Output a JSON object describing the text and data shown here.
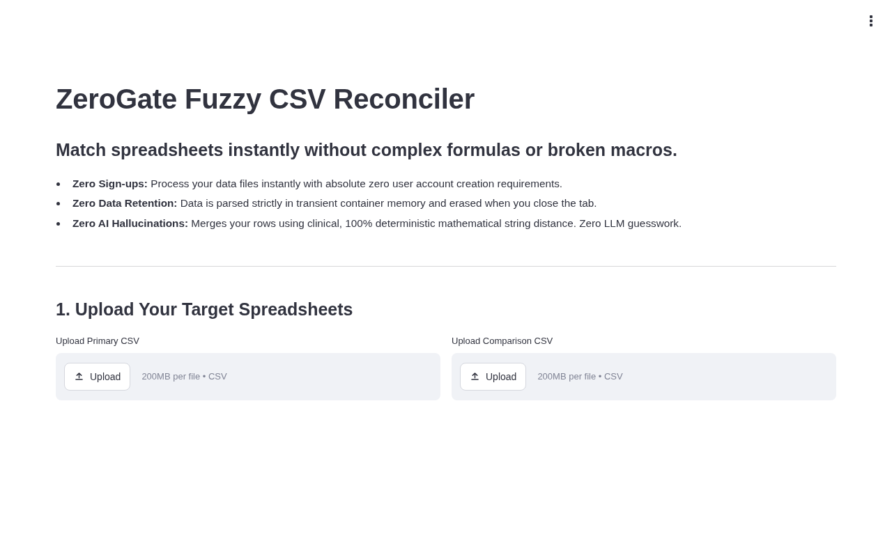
{
  "title": "ZeroGate Fuzzy CSV Reconciler",
  "subtitle": "Match spreadsheets instantly without complex formulas or broken macros.",
  "features": [
    "**Zero Sign-ups:** Process your data files instantly with absolute zero user account creation requirements.",
    "**Zero Data Retention:** Data is parsed strictly in transient container memory and erased when you close the tab.",
    "**Zero AI Hallucinations:** Merges your rows using clinical, 100% deterministic mathematical string distance. Zero LLM guesswork."
  ],
  "upload_section": {
    "heading": "1. Upload Your Target Spreadsheets",
    "uploaders": [
      {
        "label": "Upload Primary CSV",
        "button": "Upload",
        "hint": "200MB per file • CSV"
      },
      {
        "label": "Upload Comparison CSV",
        "button": "Upload",
        "hint": "200MB per file • CSV"
      }
    ]
  }
}
